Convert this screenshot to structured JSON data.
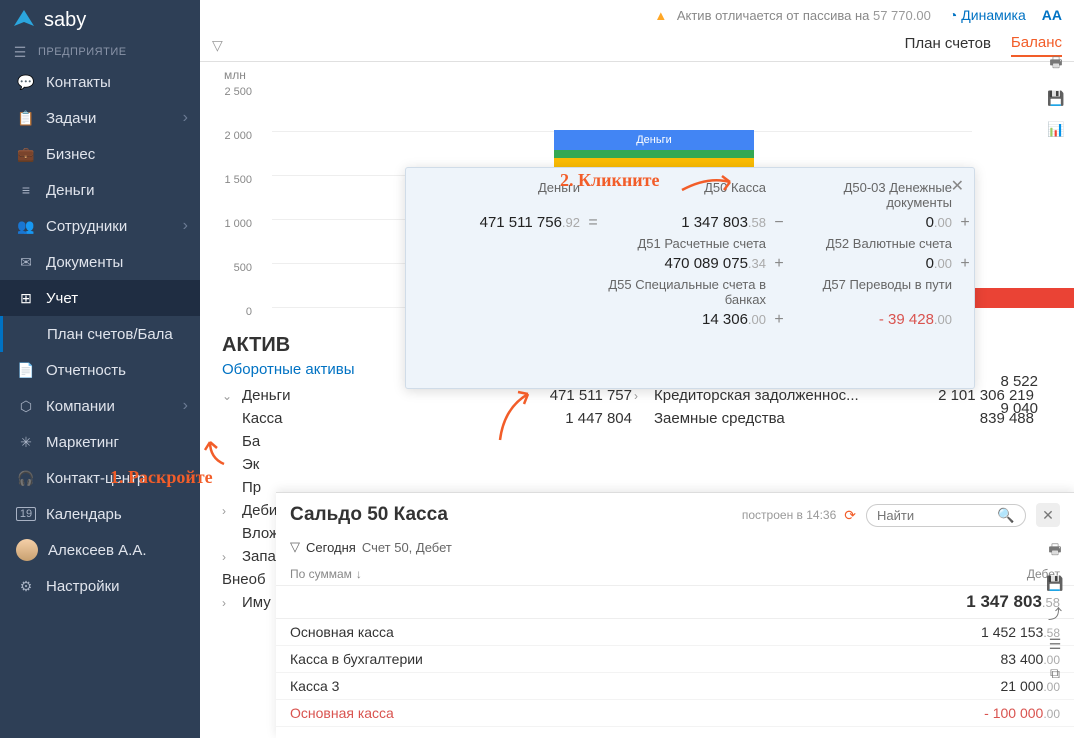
{
  "brand": "saby",
  "section_label": "ПРЕДПРИЯТИЕ",
  "nav": [
    {
      "label": "Контакты"
    },
    {
      "label": "Задачи",
      "chev": true
    },
    {
      "label": "Бизнес"
    },
    {
      "label": "Деньги"
    },
    {
      "label": "Сотрудники",
      "chev": true
    },
    {
      "label": "Документы"
    },
    {
      "label": "Учет",
      "active": true
    },
    {
      "label": "Отчетность"
    },
    {
      "label": "Компании",
      "chev": true
    },
    {
      "label": "Маркетинг"
    },
    {
      "label": "Контакт-центр"
    },
    {
      "label": "Календарь"
    },
    {
      "label": "Алексеев А.А."
    },
    {
      "label": "Настройки"
    }
  ],
  "sub_nav": "План счетов/Бала",
  "warning": {
    "text": "Актив отличается от пассива на ",
    "value": "57 770",
    "dec": ".00"
  },
  "dynamics": "Динамика",
  "font_size": "AA",
  "tabs": {
    "plan": "План счетов",
    "balance": "Баланс"
  },
  "chart": {
    "unit": "млн",
    "ticks": [
      "2 500",
      "2 000",
      "1 500",
      "1 000",
      "500",
      "0"
    ],
    "bar_label": "Деньги"
  },
  "annotation1": "1. Раскройте",
  "annotation2": "2. Кликните",
  "popup": {
    "col1": {
      "label": "Деньги",
      "val": "471 511 756",
      "dec": ".92"
    },
    "col2a": {
      "label": "Д50 Касса",
      "val": "1 347 803",
      "dec": ".58"
    },
    "col2b": {
      "label": "Д51 Расчетные счета",
      "val": "470 089 075",
      "dec": ".34"
    },
    "col2c": {
      "label": "Д55 Специальные счета в банках",
      "val": "14 306",
      "dec": ".00"
    },
    "col3a": {
      "label": "Д50-03 Денежные документы",
      "val": "0",
      "dec": ".00"
    },
    "col3b": {
      "label": "Д52 Валютные счета",
      "val": "0",
      "dec": ".00"
    },
    "col3c": {
      "label": "Д57 Переводы в пути",
      "val": "- 39 428",
      "dec": ".00"
    }
  },
  "balance": {
    "asset_title": "АКТИВ",
    "asset_sub": "Оборотные активы",
    "rows_left": [
      {
        "label": "Деньги",
        "val": "471 511 757",
        "chev": "down"
      },
      {
        "label": "Касса",
        "val": "1 447 804"
      },
      {
        "label": "Ба"
      },
      {
        "label": "Эк"
      },
      {
        "label": "Пр"
      },
      {
        "label": "Деби",
        "chev": "right"
      },
      {
        "label": "Влож"
      },
      {
        "label": "Запа",
        "chev": "right"
      },
      {
        "label": "Внеоб",
        "sub": true
      },
      {
        "label": "Иму",
        "chev": "right"
      }
    ],
    "rows_right": [
      {
        "label": "",
        "val": "8 522",
        "partial": true
      },
      {
        "label": "",
        "val": "9 040",
        "partial": true
      },
      {
        "label": "Кредиторская задолженнос...",
        "val": "2 101 306 219",
        "chev": "right"
      },
      {
        "label": "Заемные средства",
        "val": "839 488"
      }
    ]
  },
  "panel": {
    "title": "Сальдо 50 Касса",
    "built": "построен в 14:36",
    "search_placeholder": "Найти",
    "filter": {
      "today": "Сегодня",
      "rest": "Счет 50, Дебет"
    },
    "col_sum": "По суммам",
    "col_debit": "Дебет",
    "total": {
      "val": "1 347 803",
      "dec": ".58"
    },
    "rows": [
      {
        "label": "Основная касса",
        "val": "1 452 153",
        "dec": ".58"
      },
      {
        "label": "Касса в бухгалтерии",
        "val": "83 400",
        "dec": ".00"
      },
      {
        "label": "Касса 3",
        "val": "21 000",
        "dec": ".00"
      },
      {
        "label": "Основная касса",
        "val": "- 100 000",
        "dec": ".00",
        "neg": true
      }
    ]
  }
}
